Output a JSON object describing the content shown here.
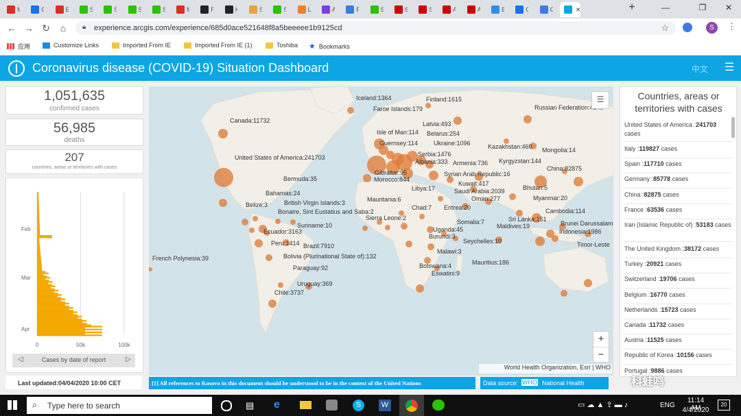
{
  "browser": {
    "tabs": [
      "M",
      "G",
      "E",
      "S",
      "S",
      "S",
      "S",
      "M",
      "R",
      "H",
      "S",
      "S",
      "L",
      "A",
      "P",
      "S",
      "S",
      "S",
      "A",
      "A",
      "E",
      "G",
      "C",
      "C"
    ],
    "active_tab_close": "✕",
    "new_tab": "+",
    "url": "experience.arcgis.com/experience/685d0ace521648f8a5beeeee1b9125cd",
    "bookmarks": [
      "应用",
      "Customize Links",
      "Imported From IE",
      "Imported From IE (1)",
      "Toshiba",
      "Bookmarks"
    ],
    "profile_initial": "S"
  },
  "header": {
    "title": "Coronavirus disease (COVID-19) Situation Dashboard",
    "lang": "中文",
    "accent": "#0da5e4"
  },
  "stats": {
    "confirmed_value": "1,051,635",
    "confirmed_label": "confirmed cases",
    "deaths_value": "56,985",
    "deaths_label": "deaths",
    "countries_value": "207",
    "countries_label": "countries, areas or territories with cases"
  },
  "epi_chart": {
    "y_ticks": [
      "Feb",
      "Mar",
      "Apr"
    ],
    "x_ticks": [
      "0",
      "50k",
      "100k"
    ],
    "footer_label": "Cases by date of report",
    "bar_color": "#f5a800"
  },
  "last_updated": "Last updated:04/04/2020 10:00 CET",
  "map": {
    "labels": [
      {
        "t": "Iceland:1364",
        "x": 302,
        "y": 20
      },
      {
        "t": "Finland:1615",
        "x": 404,
        "y": 22
      },
      {
        "t": "Faroe Islands:179",
        "x": 327,
        "y": 36
      },
      {
        "t": "Russian Federation:4149",
        "x": 562,
        "y": 34
      },
      {
        "t": "Canada:11732",
        "x": 118,
        "y": 53
      },
      {
        "t": "Latvia:493",
        "x": 399,
        "y": 58
      },
      {
        "t": "Isle of Man:114",
        "x": 332,
        "y": 70
      },
      {
        "t": "Belarus:254",
        "x": 405,
        "y": 72
      },
      {
        "t": "Guernsey:114",
        "x": 336,
        "y": 86
      },
      {
        "t": "Ukraine:1096",
        "x": 415,
        "y": 86
      },
      {
        "t": "Kazakhstan:460",
        "x": 494,
        "y": 91
      },
      {
        "t": "Mongolia:14",
        "x": 573,
        "y": 96
      },
      {
        "t": "Serbia:1476",
        "x": 392,
        "y": 102
      },
      {
        "t": "United States of America:241703",
        "x": 125,
        "y": 107
      },
      {
        "t": "Albania:333",
        "x": 388,
        "y": 113
      },
      {
        "t": "Armenia:736",
        "x": 443,
        "y": 115
      },
      {
        "t": "Kyrgyzstan:144",
        "x": 510,
        "y": 112
      },
      {
        "t": "Gibraltar:95",
        "x": 329,
        "y": 129
      },
      {
        "t": "China:82875",
        "x": 580,
        "y": 123
      },
      {
        "t": "Syrian Arab Republic:16",
        "x": 430,
        "y": 131
      },
      {
        "t": "Morocco:844",
        "x": 328,
        "y": 139
      },
      {
        "t": "Bermuda:35",
        "x": 196,
        "y": 138
      },
      {
        "t": "Kuwait:417",
        "x": 451,
        "y": 145
      },
      {
        "t": "Libya:17",
        "x": 383,
        "y": 152
      },
      {
        "t": "Saudi Arabia:2039",
        "x": 445,
        "y": 156
      },
      {
        "t": "Bhutan:5",
        "x": 545,
        "y": 151
      },
      {
        "t": "Bahamas:24",
        "x": 170,
        "y": 159
      },
      {
        "t": "Oman:277",
        "x": 470,
        "y": 167
      },
      {
        "t": "Myanmar:20",
        "x": 560,
        "y": 166
      },
      {
        "t": "Mauritania:6",
        "x": 318,
        "y": 168
      },
      {
        "t": "British Virgin Islands:3",
        "x": 197,
        "y": 173
      },
      {
        "t": "Belize:3",
        "x": 141,
        "y": 176
      },
      {
        "t": "Chad:7",
        "x": 383,
        "y": 180
      },
      {
        "t": "Eritrea:20",
        "x": 430,
        "y": 180
      },
      {
        "t": "Bonaire, Sint Eustatius and Saba:2",
        "x": 188,
        "y": 186
      },
      {
        "t": "Cambodia:114",
        "x": 578,
        "y": 185
      },
      {
        "t": "Sierra Leone:2",
        "x": 316,
        "y": 195
      },
      {
        "t": "Sri Lanka:151",
        "x": 524,
        "y": 197
      },
      {
        "t": "Brunei Darussalam",
        "x": 600,
        "y": 203
      },
      {
        "t": "Somalia:7",
        "x": 449,
        "y": 201
      },
      {
        "t": "Maldives:19",
        "x": 507,
        "y": 207
      },
      {
        "t": "Suriname:10",
        "x": 216,
        "y": 206
      },
      {
        "t": "Uganda:45",
        "x": 414,
        "y": 212
      },
      {
        "t": "Indonesia:1986",
        "x": 598,
        "y": 215
      },
      {
        "t": "Ecuador:3163",
        "x": 167,
        "y": 215
      },
      {
        "t": "Burundi:3",
        "x": 408,
        "y": 222
      },
      {
        "t": "Seychelles:10",
        "x": 458,
        "y": 229
      },
      {
        "t": "Timor-Leste",
        "x": 624,
        "y": 234
      },
      {
        "t": "Peru:1414",
        "x": 178,
        "y": 232
      },
      {
        "t": "Brazil:7910",
        "x": 225,
        "y": 236
      },
      {
        "t": "Malawi:3",
        "x": 420,
        "y": 244
      },
      {
        "t": "French Polynesia:39",
        "x": 5,
        "y": 254
      },
      {
        "t": "Bolivia (Plurinational State of):132",
        "x": 196,
        "y": 251
      },
      {
        "t": "Mauritius:186",
        "x": 471,
        "y": 260
      },
      {
        "t": "Botswana:4",
        "x": 394,
        "y": 265
      },
      {
        "t": "Paraguay:92",
        "x": 210,
        "y": 268
      },
      {
        "t": "Eswatini:9",
        "x": 412,
        "y": 276
      },
      {
        "t": "Uruguay:369",
        "x": 216,
        "y": 291
      },
      {
        "t": "Chile:3737",
        "x": 183,
        "y": 304
      }
    ],
    "attribution": "World Health Organization, Esri | WHO",
    "zoom_in": "+",
    "zoom_out": "−"
  },
  "footer": {
    "kosovo_note": "[1] All references to Kosovo in this document should be understood to be in the context of the United Nations",
    "data_source_prefix": "Data source:",
    "data_source_who": "WHO",
    "data_source_suffix": "National Health"
  },
  "country_list": {
    "title": "Countries, areas or territories with cases",
    "items": [
      {
        "name": "United States of America :",
        "value": "241703",
        "unit": "cases"
      },
      {
        "name": "Italy :",
        "value": "119827",
        "unit": "cases"
      },
      {
        "name": "Spain :",
        "value": "117710",
        "unit": "cases"
      },
      {
        "name": "Germany :",
        "value": "85778",
        "unit": "cases"
      },
      {
        "name": "China :",
        "value": "82875",
        "unit": "cases"
      },
      {
        "name": "France :",
        "value": "63536",
        "unit": "cases"
      },
      {
        "name": "Iran (Islamic Republic of) :",
        "value": "53183",
        "unit": "cases"
      },
      {
        "name": "The United Kingdom :",
        "value": "38172",
        "unit": "cases"
      },
      {
        "name": "Turkey :",
        "value": "20921",
        "unit": "cases"
      },
      {
        "name": "Switzerland :",
        "value": "19706",
        "unit": "cases"
      },
      {
        "name": "Belgium :",
        "value": "16770",
        "unit": "cases"
      },
      {
        "name": "Netherlands :",
        "value": "15723",
        "unit": "cases"
      },
      {
        "name": "Canada :",
        "value": "11732",
        "unit": "cases"
      },
      {
        "name": "Austria :",
        "value": "11525",
        "unit": "cases"
      },
      {
        "name": "Republic of Korea :",
        "value": "10156",
        "unit": "cases"
      },
      {
        "name": "Portugal :",
        "value": "9886",
        "unit": "cases"
      }
    ]
  },
  "watermark": "科蛙鸣",
  "taskbar": {
    "search_placeholder": "Type here to search",
    "lang": "ENG",
    "time": "11:14 AM",
    "date": "4/4/2020",
    "notif_count": "20"
  }
}
